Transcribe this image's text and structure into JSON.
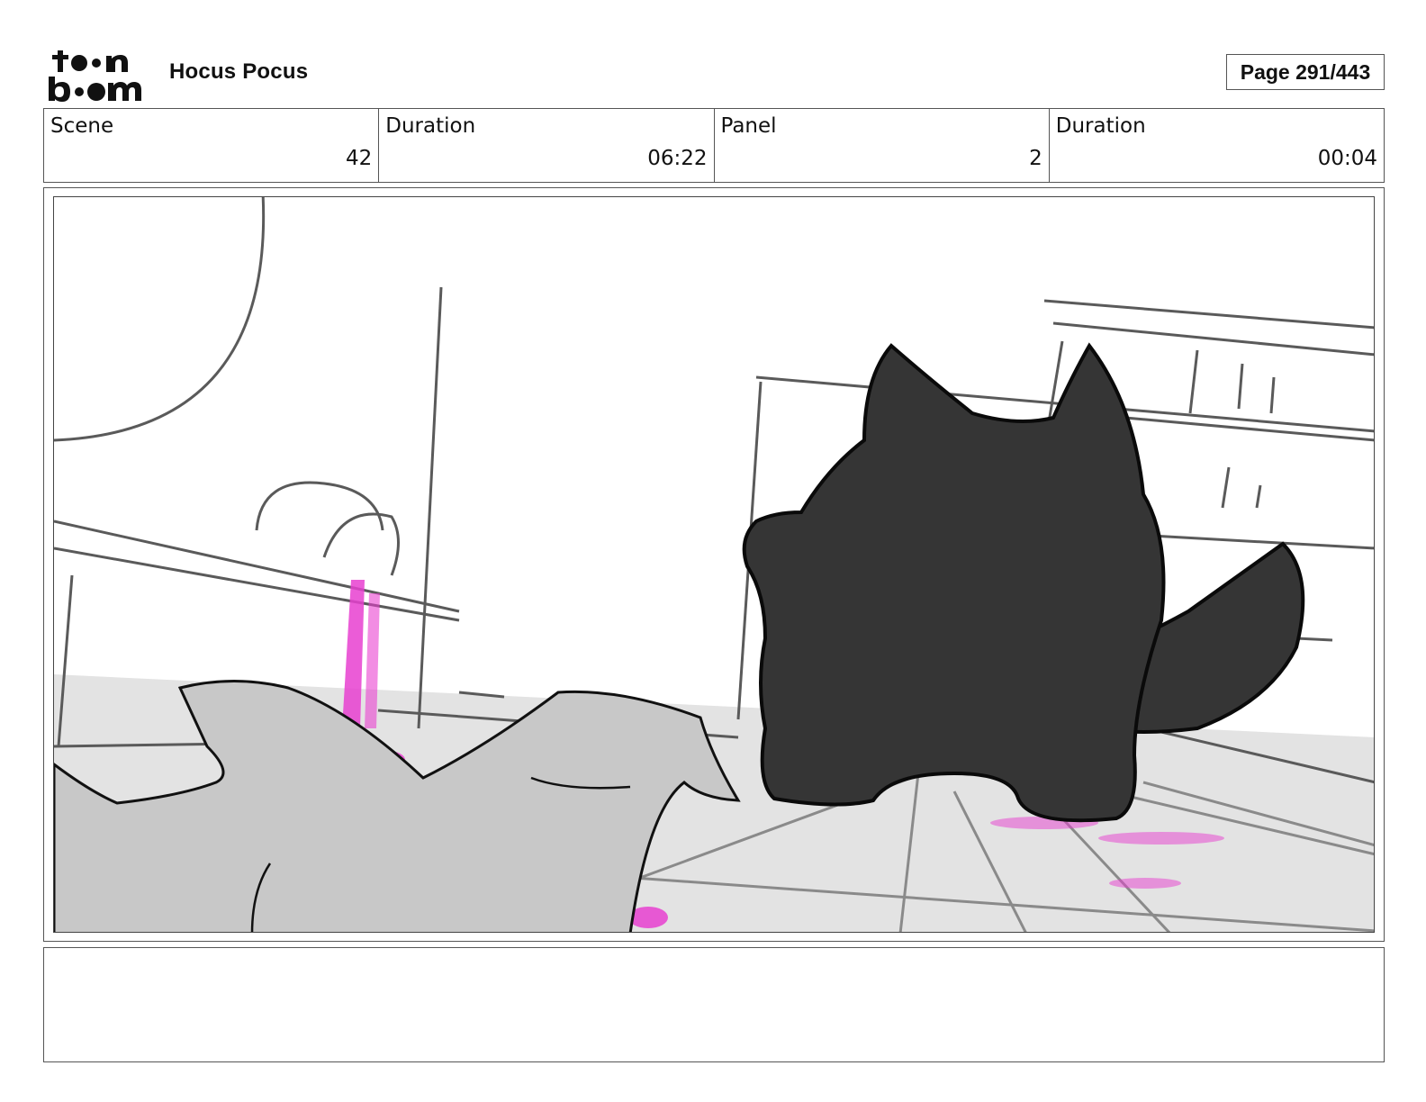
{
  "header": {
    "project_title": "Hocus Pocus",
    "page_label": "Page 291/443"
  },
  "info": [
    {
      "label": "Scene",
      "value": "42"
    },
    {
      "label": "Duration",
      "value": "06:22"
    },
    {
      "label": "Panel",
      "value": "2"
    },
    {
      "label": "Duration",
      "value": "00:04"
    }
  ],
  "notes": {
    "text": ""
  },
  "colors": {
    "accent_magenta": "#e83fd0",
    "cat_fill": "#353535",
    "floor_gray": "#e3e3e3",
    "foreground_gray": "#c8c8c8"
  }
}
